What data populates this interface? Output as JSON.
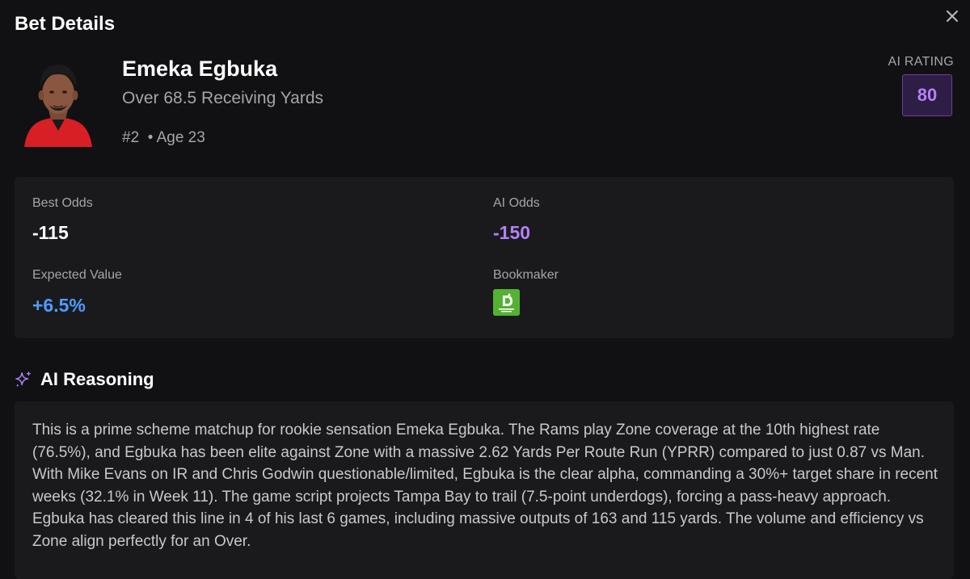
{
  "header": {
    "title": "Bet Details",
    "close_icon": "close-icon"
  },
  "player": {
    "name": "Emeka Egbuka",
    "bet_line": "Over 68.5 Receiving Yards",
    "meta": "#2  • Age 23",
    "avatar": "player-headshot"
  },
  "rating": {
    "label": "AI RATING",
    "value": "80",
    "accent": "#b481f5"
  },
  "stats": {
    "best_odds": {
      "label": "Best Odds",
      "value": "-115"
    },
    "ai_odds": {
      "label": "AI Odds",
      "value": "-150",
      "color": "#b481f5"
    },
    "expected_value": {
      "label": "Expected Value",
      "value": "+6.5%",
      "color": "#4f9bff"
    },
    "bookmaker": {
      "label": "Bookmaker",
      "logo": "draftkings-logo",
      "logo_color": "#53b232"
    }
  },
  "reasoning": {
    "icon": "sparkle-icon",
    "title": "AI Reasoning",
    "text": "This is a prime scheme matchup for rookie sensation Emeka Egbuka. The Rams play Zone coverage at the 10th highest rate (76.5%), and Egbuka has been elite against Zone with a massive 2.62 Yards Per Route Run (YPRR) compared to just 0.87 vs Man. With Mike Evans on IR and Chris Godwin questionable/limited, Egbuka is the clear alpha, commanding a 30%+ target share in recent weeks (32.1% in Week 11). The game script projects Tampa Bay to trail (7.5-point underdogs), forcing a pass-heavy approach. Egbuka has cleared this line in 4 of his last 6 games, including massive outputs of 163 and 115 yards. The volume and efficiency vs Zone align perfectly for an Over."
  }
}
